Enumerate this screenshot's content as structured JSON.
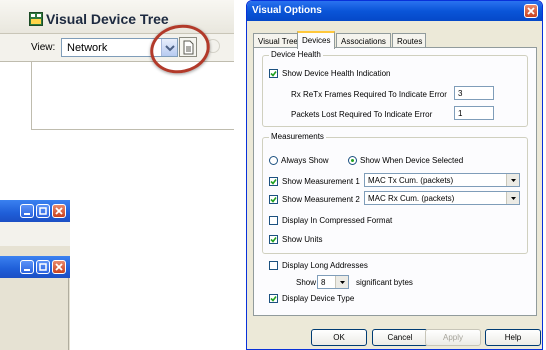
{
  "device_tree": {
    "title": "Visual Device Tree",
    "view_label": "View:",
    "view_value": "Network",
    "icons": [
      "app-icon",
      "chevron-down-icon",
      "document-icon"
    ]
  },
  "bg_windows": {
    "icons": [
      "minimize-icon",
      "restore-icon",
      "close-icon"
    ]
  },
  "dialog": {
    "title": "Visual Options",
    "tabs": [
      {
        "label": "Visual Tree",
        "active": false
      },
      {
        "label": "Devices",
        "active": true
      },
      {
        "label": "Associations",
        "active": false
      },
      {
        "label": "Routes",
        "active": false
      }
    ],
    "device_health": {
      "legend": "Device Health",
      "show_indication": {
        "label": "Show Device Health Indication",
        "checked": true
      },
      "rx_retx": {
        "label": "Rx ReTx Frames Required To Indicate Error",
        "value": "3"
      },
      "packets_lost": {
        "label": "Packets Lost Required To Indicate Error",
        "value": "1"
      }
    },
    "measurements": {
      "legend": "Measurements",
      "always_show": {
        "label": "Always Show",
        "selected": false
      },
      "show_when_selected": {
        "label": "Show When Device Selected",
        "selected": true
      },
      "measurement1": {
        "label": "Show Measurement 1",
        "checked": true,
        "value": "MAC Tx Cum. (packets)"
      },
      "measurement2": {
        "label": "Show Measurement 2",
        "checked": true,
        "value": "MAC Rx Cum. (packets)"
      },
      "compressed": {
        "label": "Display In Compressed Format",
        "checked": false
      },
      "units": {
        "label": "Show Units",
        "checked": true
      }
    },
    "long_addresses": {
      "label": "Display Long Addresses",
      "checked": false
    },
    "show_bytes": {
      "prefix": "Show",
      "value": "8",
      "suffix": "significant bytes"
    },
    "device_type": {
      "label": "Display Device Type",
      "checked": true
    },
    "buttons": {
      "ok": "OK",
      "cancel": "Cancel",
      "apply": "Apply",
      "help": "Help"
    },
    "colors": {
      "title_bar": "#0a55d8",
      "dialog_bg": "#ece9d8",
      "highlight": "#b23a2a",
      "active_tab": "#ffc83c"
    }
  }
}
